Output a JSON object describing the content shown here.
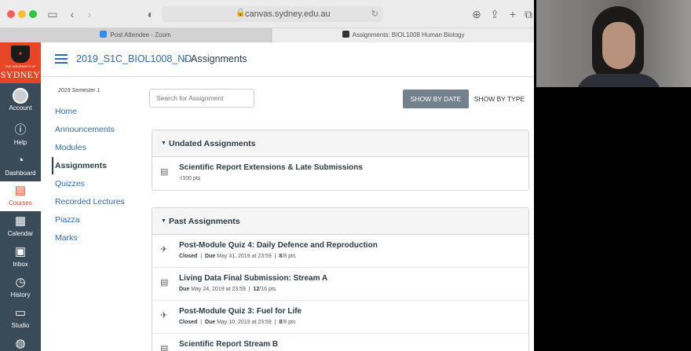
{
  "browser": {
    "url": "canvas.sydney.edu.au",
    "tabs": [
      {
        "label": "Post Attendee - Zoom",
        "color": "#2d8cff"
      },
      {
        "label": "Assignments: BIOL1008 Human Biology",
        "color": "#333333"
      }
    ]
  },
  "logo": {
    "line1": "THE UNIVERSITY OF",
    "line2": "SYDNEY"
  },
  "global_nav": [
    {
      "label": "Account",
      "icon": "avatar-icon"
    },
    {
      "label": "Help",
      "icon": "help-icon"
    },
    {
      "label": "Dashboard",
      "icon": "dashboard-icon"
    },
    {
      "label": "Courses",
      "icon": "courses-icon"
    },
    {
      "label": "Calendar",
      "icon": "calendar-icon"
    },
    {
      "label": "Inbox",
      "icon": "inbox-icon"
    },
    {
      "label": "History",
      "icon": "history-icon"
    },
    {
      "label": "Studio",
      "icon": "studio-icon"
    }
  ],
  "breadcrumb": {
    "course": "2019_S1C_BIOL1008_ND",
    "separator": "›",
    "page": "Assignments"
  },
  "course_nav": {
    "semester": "2019 Semester 1",
    "items": [
      "Home",
      "Announcements",
      "Modules",
      "Assignments",
      "Quizzes",
      "Recorded Lectures",
      "Piazza",
      "Marks"
    ]
  },
  "toolbar": {
    "search_placeholder": "Search for Assignment",
    "show_by_date": "SHOW BY DATE",
    "show_by_type": "SHOW BY TYPE"
  },
  "groups": {
    "undated": {
      "title": "Undated Assignments",
      "items": [
        {
          "title": "Scientific Report Extensions & Late Submissions",
          "points": "-/100 pts"
        }
      ]
    },
    "past": {
      "title": "Past Assignments",
      "items": [
        {
          "title": "Post-Module Quiz 4: Daily Defence and Reproduction",
          "status": "Closed",
          "due_label": "Due",
          "due": "May 31, 2019 at 23:59",
          "score": "8",
          "out_of": "/8 pts",
          "icon": "quiz-rocket-icon"
        },
        {
          "title": "Living Data Final Submission: Stream A",
          "status": "",
          "due_label": "Due",
          "due": "May 24, 2019 at 23:59",
          "score": "12",
          "out_of": "/16 pts",
          "icon": "assignment-icon"
        },
        {
          "title": "Post-Module Quiz 3: Fuel for Life",
          "status": "Closed",
          "due_label": "Due",
          "due": "May 10, 2019 at 23:59",
          "score": "8",
          "out_of": "/8 pts",
          "icon": "quiz-rocket-icon"
        },
        {
          "title": "Scientific Report Stream B",
          "status": "",
          "due_label": "",
          "due": "",
          "score": "",
          "out_of": "",
          "icon": "assignment-icon"
        }
      ]
    }
  },
  "colors": {
    "brand": "#e64626",
    "nav": "#394b58",
    "link": "#2d6ab6"
  }
}
